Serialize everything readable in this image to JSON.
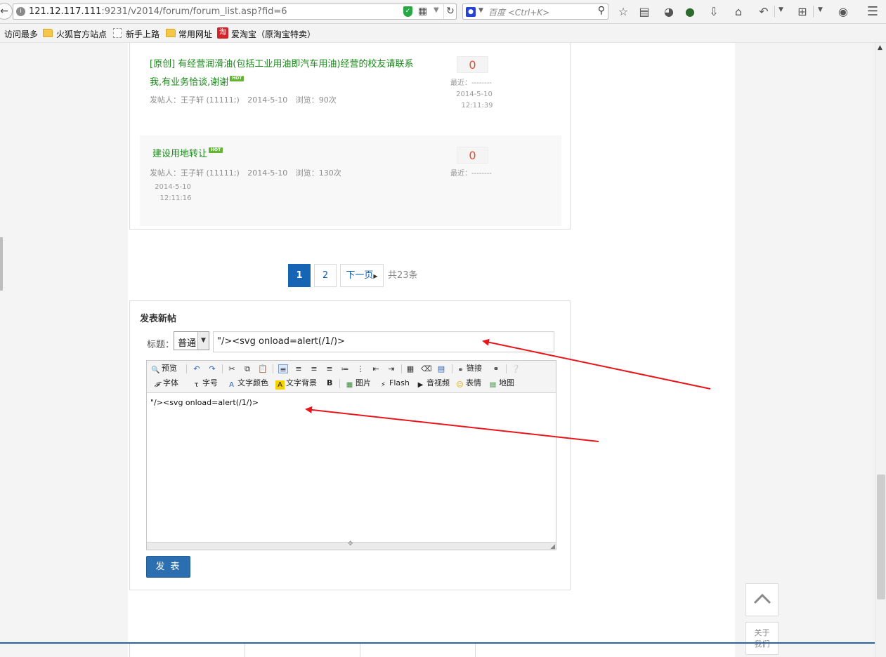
{
  "browser": {
    "url_host": "121.12.117.111",
    "url_rest": ":9231/v2014/forum/forum_list.asp?fid=6",
    "search_placeholder": "百度 <Ctrl+K>"
  },
  "bookmarks": [
    {
      "label": "访问最多"
    },
    {
      "label": "火狐官方站点"
    },
    {
      "label": "新手上路"
    },
    {
      "label": "常用网址"
    },
    {
      "label": "爱淘宝（原淘宝特卖）"
    }
  ],
  "posts": [
    {
      "tag": "[原创]",
      "title": "有经营润滑油(包括工业用油即汽车用油)经营的校友请联系我,有业务恰谈,谢谢",
      "hot": "HOT",
      "author": "发帖人：王子轩 (11111;)",
      "date": "2014-5-10",
      "views": "浏览：90次",
      "count": "0",
      "recent": "最近：--------",
      "time_date": "2014-5-10",
      "time_clock": "12:11:39"
    },
    {
      "tag": "",
      "title": "建设用地转让",
      "hot": "HOT",
      "author": "发帖人：王子轩 (11111;)",
      "date": "2014-5-10",
      "views": "浏览：130次",
      "count": "0",
      "recent": "最近：--------",
      "time_date": "2014-5-10",
      "time_clock": "12:11:16"
    }
  ],
  "pager": {
    "pages": [
      "1",
      "2"
    ],
    "next": "下一页",
    "total": "共23条"
  },
  "editor": {
    "heading": "发表新帖",
    "title_label": "标题：",
    "type_value": "普通",
    "title_value": "\"/><svg onload=alert(/1/)>",
    "body_text": "\"/><svg onload=alert(/1/)>",
    "submit": "发 表",
    "toolbar": {
      "preview": "预览",
      "link": "链接",
      "font": "字体",
      "size": "字号",
      "color": "文字颜色",
      "bg": "文字背景",
      "bold": "B",
      "image": "图片",
      "flash": "Flash",
      "media": "音视频",
      "emoticon": "表情",
      "map": "地图"
    }
  },
  "side": {
    "about": "关于我们"
  },
  "colors": {
    "accent": "#1864b4",
    "post_title": "#1a8a1a",
    "count": "#e64c2e",
    "annotation_arrow": "#e8161a"
  }
}
